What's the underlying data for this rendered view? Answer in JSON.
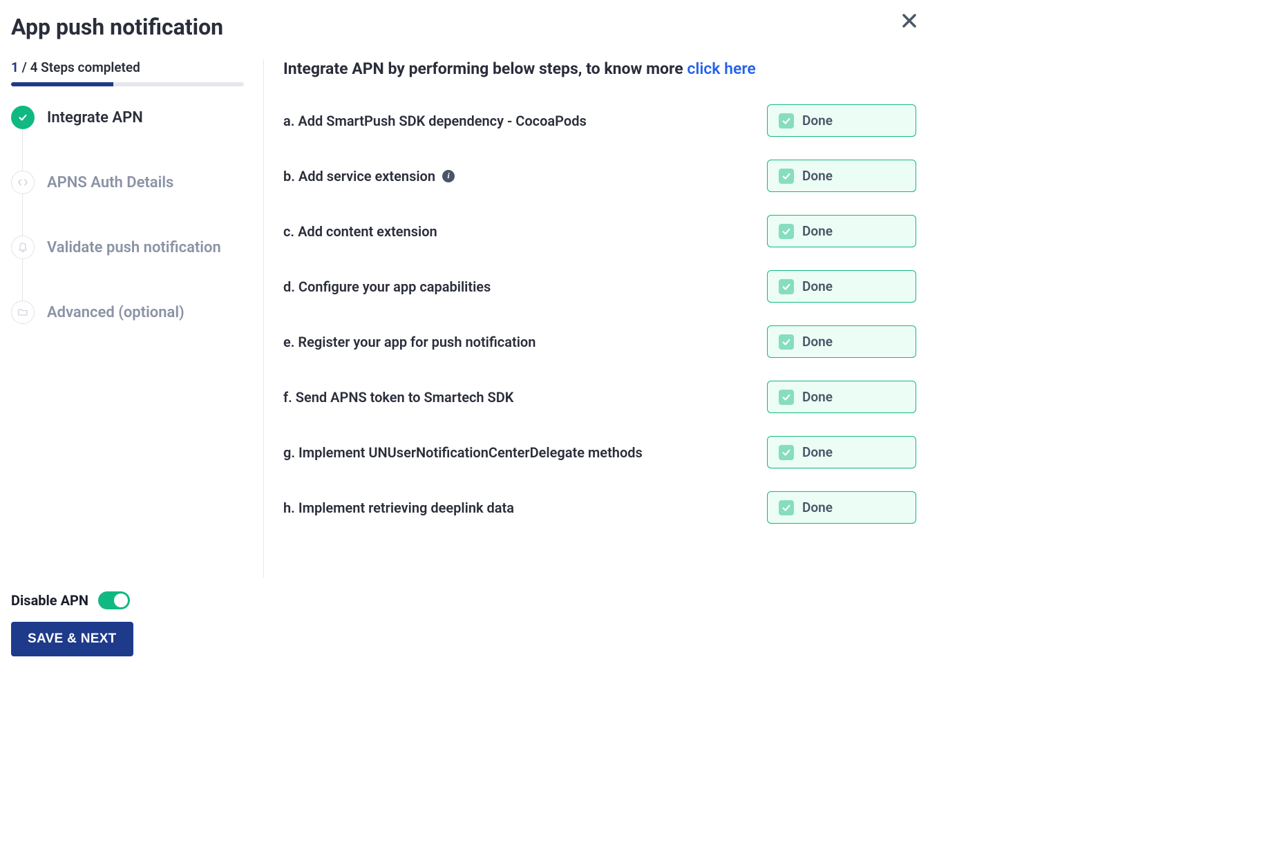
{
  "header": {
    "title": "App push notification"
  },
  "progress": {
    "current": "1",
    "suffix": " / 4 Steps completed"
  },
  "steps": [
    {
      "label": "Integrate APN",
      "completed": true
    },
    {
      "label": "APNS Auth Details",
      "completed": false
    },
    {
      "label": "Validate push notification",
      "completed": false
    },
    {
      "label": "Advanced (optional)",
      "completed": false
    }
  ],
  "main": {
    "heading_prefix": "Integrate APN by performing below steps, to know more  ",
    "heading_link": "click here"
  },
  "tasks": [
    {
      "label": "a. Add SmartPush SDK dependency - CocoaPods",
      "status": "Done",
      "info": false
    },
    {
      "label": "b. Add service extension",
      "status": "Done",
      "info": true
    },
    {
      "label": "c. Add content extension",
      "status": "Done",
      "info": false
    },
    {
      "label": "d. Configure your app capabilities",
      "status": "Done",
      "info": false
    },
    {
      "label": "e. Register your app for push notification",
      "status": "Done",
      "info": false
    },
    {
      "label": "f. Send APNS token to Smartech SDK",
      "status": "Done",
      "info": false
    },
    {
      "label": "g. Implement UNUserNotificationCenterDelegate methods",
      "status": "Done",
      "info": false
    },
    {
      "label": "h. Implement retrieving deeplink data",
      "status": "Done",
      "info": false
    }
  ],
  "footer": {
    "toggle_label": "Disable APN",
    "save_label": "SAVE & NEXT"
  }
}
